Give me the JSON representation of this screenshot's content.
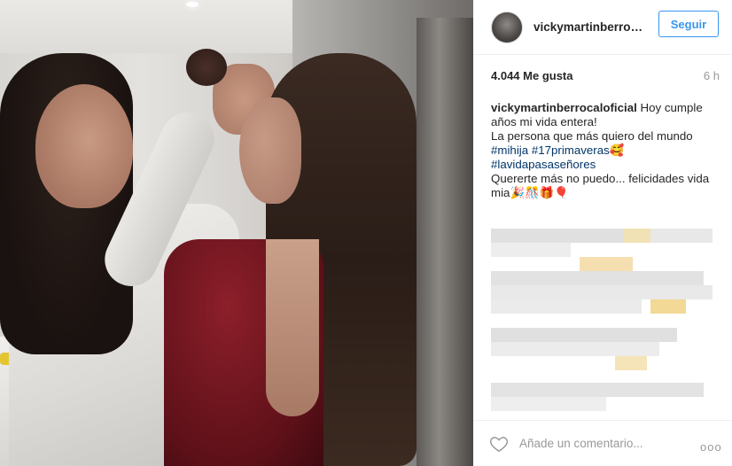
{
  "post": {
    "username": "vickymartinberroca...",
    "follow_label": "Seguir",
    "likes": "4.044 Me gusta",
    "time": "6 h",
    "caption": {
      "user": "vickymartinberrocaloficial",
      "text1": " Hoy cumple años mi vida entera!",
      "text2": "La persona que más quiero del mundo",
      "tag1": "#mihija",
      "tag2": "#17primaveras",
      "emoji1": "🥰",
      "tag3": "#lavidapasaseñores",
      "text3": "Quererte más no puedo... felicidades vida mia",
      "emoji2": "🎉🎊🎁🎈"
    },
    "comment_placeholder": "Añade un comentario...",
    "more_label": "ooo"
  },
  "icons": {
    "heart": "heart-outline-icon",
    "avatar": "avatar"
  },
  "colors": {
    "accent": "#3897f0",
    "hashtag": "#003569"
  }
}
